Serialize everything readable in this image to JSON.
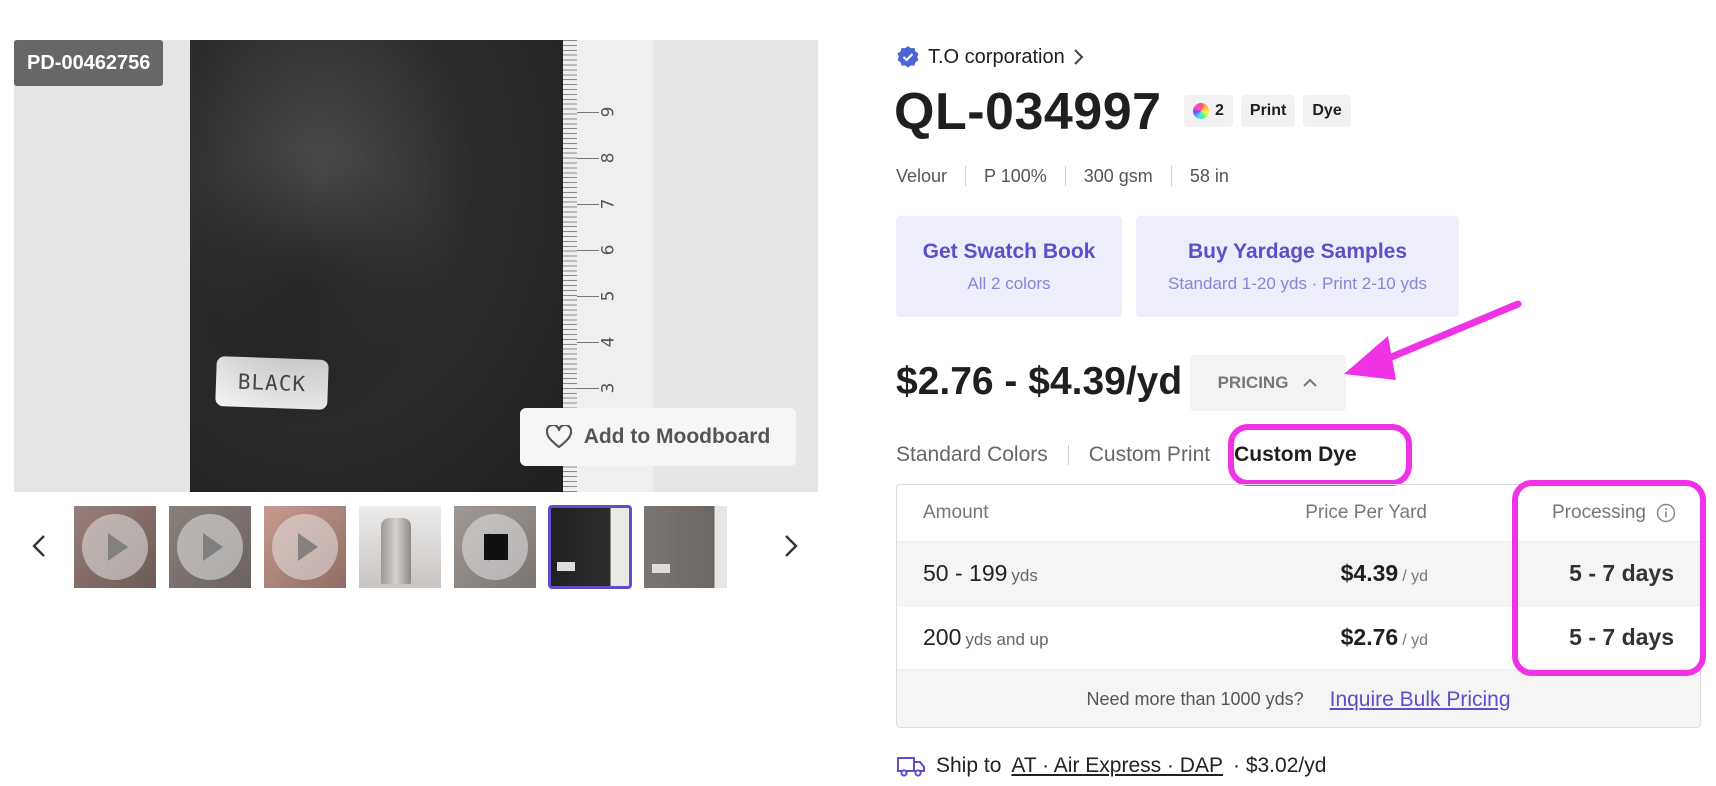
{
  "gallery": {
    "sku": "PD-00462756",
    "swatch_label": "BLACK",
    "ruler_numbers": [
      "9",
      "8",
      "7",
      "6",
      "5",
      "4",
      "3"
    ],
    "moodboard_label": "Add to Moodboard",
    "thumbnails": [
      {
        "type": "video",
        "active": false
      },
      {
        "type": "video",
        "active": false
      },
      {
        "type": "video",
        "active": false
      },
      {
        "type": "image",
        "active": false
      },
      {
        "type": "video",
        "active": false
      },
      {
        "type": "image",
        "active": true
      },
      {
        "type": "image",
        "active": false
      }
    ]
  },
  "product": {
    "supplier": "T.O corporation",
    "title": "QL-034997",
    "chips": {
      "colors_count": "2",
      "print": "Print",
      "dye": "Dye"
    },
    "specs": [
      "Velour",
      "P 100%",
      "300 gsm",
      "58 in"
    ],
    "swatch_book": {
      "title": "Get Swatch Book",
      "subtitle": "All 2 colors"
    },
    "yardage": {
      "title": "Buy Yardage Samples",
      "subtitle": "Standard 1-20 yds · Print 2-10 yds"
    },
    "price_range": "$2.76 - $4.39/yd",
    "pricing_label": "PRICING"
  },
  "tabs": {
    "standard": "Standard Colors",
    "print": "Custom Print",
    "dye": "Custom Dye"
  },
  "pricing_table": {
    "headers": {
      "amount": "Amount",
      "price": "Price Per Yard",
      "processing": "Processing"
    },
    "rows": [
      {
        "amount": "50 - 199",
        "amount_unit": "yds",
        "price": "$4.39",
        "price_unit": "/ yd",
        "processing": "5 - 7 days"
      },
      {
        "amount": "200",
        "amount_unit": "yds and up",
        "price": "$2.76",
        "price_unit": "/ yd",
        "processing": "5 - 7 days"
      }
    ],
    "footer_text": "Need more than 1000 yds?",
    "footer_link": "Inquire Bulk Pricing"
  },
  "shipping": {
    "prefix": "Ship to",
    "destination": "AT · Air Express · DAP",
    "price": "· $3.02/yd"
  },
  "colors": {
    "accent": "#5b50c9",
    "highlight": "#f032e6"
  }
}
